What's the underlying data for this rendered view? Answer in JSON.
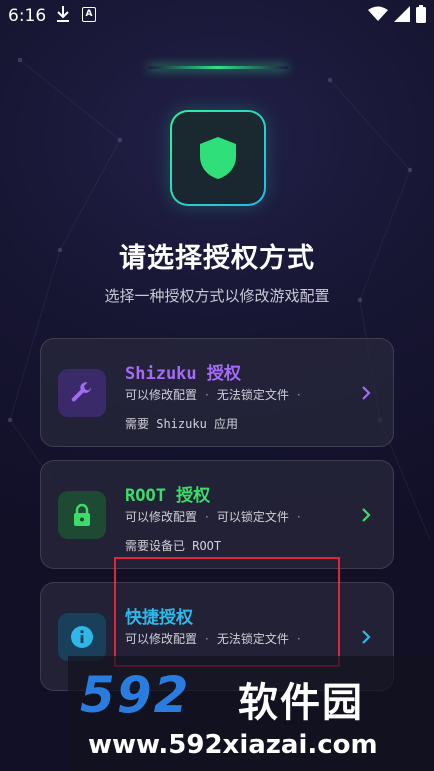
{
  "status_bar": {
    "time": "6:16"
  },
  "header": {
    "title": "请选择授权方式",
    "subtitle": "选择一种授权方式以修改游戏配置"
  },
  "options": [
    {
      "title": "Shizuku 授权",
      "feature1": "可以修改配置",
      "feature2": "无法锁定文件",
      "requirement": "需要 Shizuku 应用",
      "accent": "#a46cf5",
      "icon": "wrench-icon"
    },
    {
      "title": "ROOT 授权",
      "feature1": "可以修改配置",
      "feature2": "可以锁定文件",
      "requirement": "需要设备已 ROOT",
      "accent": "#3ddc6a",
      "icon": "lock-icon"
    },
    {
      "title": "快捷授权",
      "feature1": "可以修改配置",
      "feature2": "无法锁定文件",
      "accent": "#2eb8ea",
      "icon": "info-icon"
    }
  ],
  "watermark": {
    "brand_number": "592",
    "brand_name": "软件园",
    "url": "www.592xiazai.com"
  },
  "colors": {
    "background": "#151430",
    "shield": "#2fe07a",
    "annotation_box": "#e0263a"
  }
}
